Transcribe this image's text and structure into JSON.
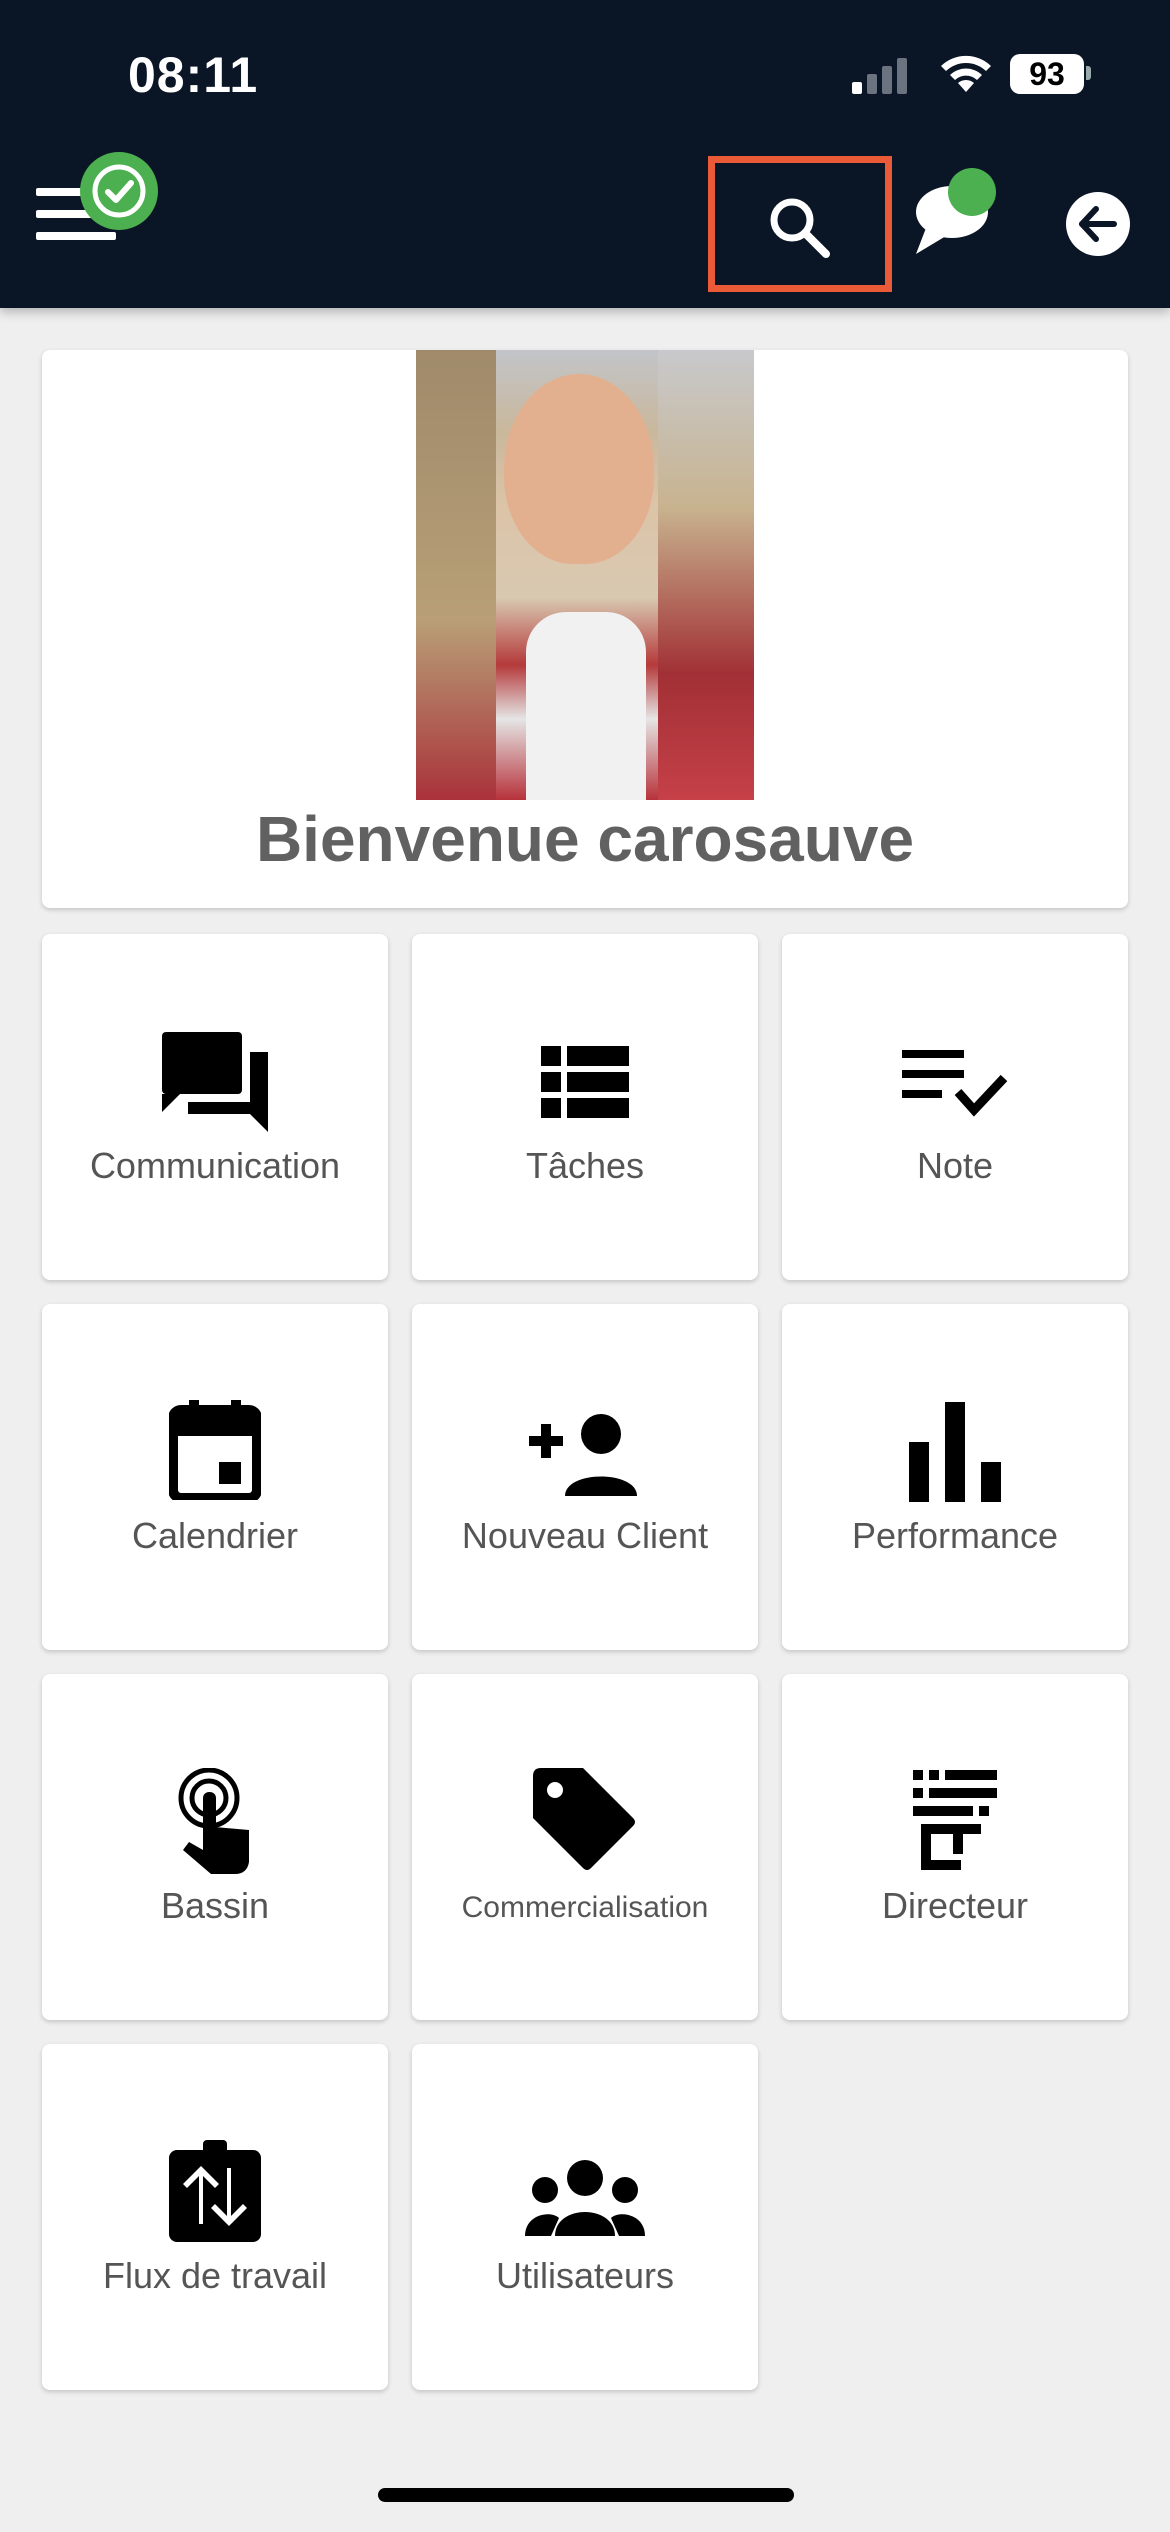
{
  "status_bar": {
    "time": "08:11",
    "battery": "93"
  },
  "header": {
    "menu_icon": "hamburger-menu-icon",
    "status_icon": "check-circle-icon",
    "search_icon": "search-icon",
    "chat_icon": "chat-bubble-icon",
    "back_icon": "arrow-left-icon",
    "highlight_color": "#ea5a37",
    "bar_color": "#0a1525"
  },
  "welcome": {
    "text": "Bienvenue carosauve"
  },
  "tiles": [
    {
      "label": "Communication",
      "icon": "forum-icon"
    },
    {
      "label": "Tâches",
      "icon": "list-view-icon"
    },
    {
      "label": "Note",
      "icon": "checklist-icon"
    },
    {
      "label": "Calendrier",
      "icon": "calendar-icon"
    },
    {
      "label": "Nouveau Client",
      "icon": "person-add-icon"
    },
    {
      "label": "Performance",
      "icon": "bar-chart-icon"
    },
    {
      "label": "Bassin",
      "icon": "touch-app-icon"
    },
    {
      "label": "Commercialisation",
      "icon": "tag-icon"
    },
    {
      "label": "Directeur",
      "icon": "org-chart-icon"
    },
    {
      "label": "Flux de travail",
      "icon": "swap-vertical-clipboard-icon"
    },
    {
      "label": "Utilisateurs",
      "icon": "group-icon"
    }
  ]
}
